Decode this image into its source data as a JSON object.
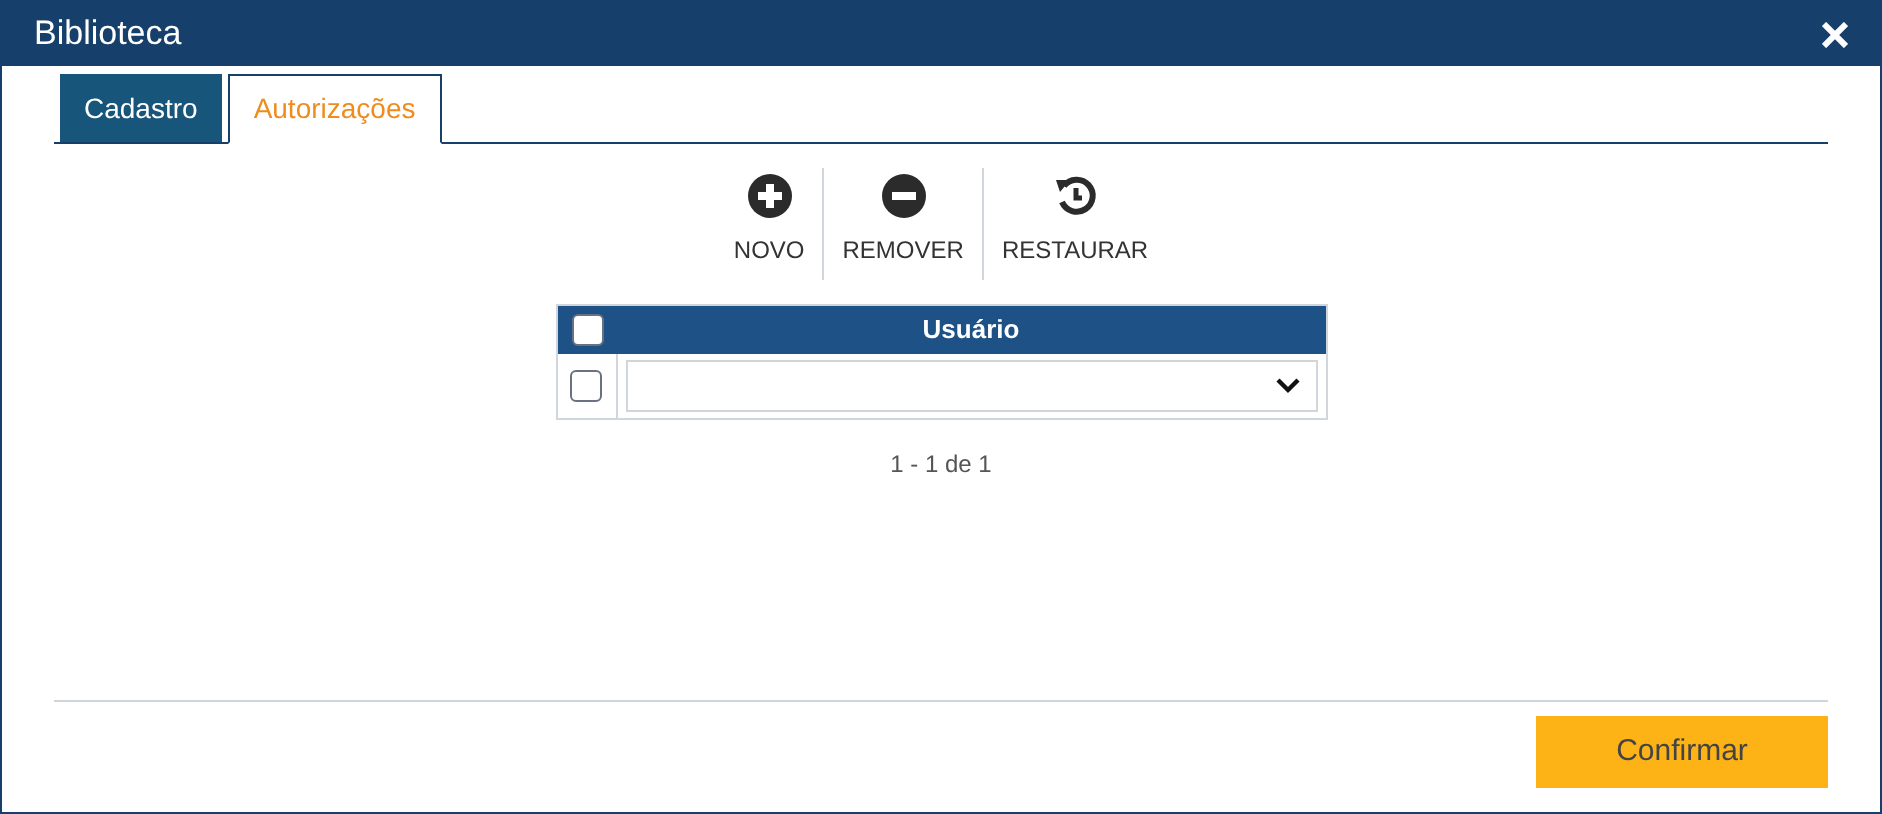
{
  "window": {
    "title": "Biblioteca"
  },
  "tabs": [
    {
      "label": "Cadastro",
      "selected": false
    },
    {
      "label": "Autorizações",
      "selected": true
    }
  ],
  "toolbar": [
    {
      "kind": "add",
      "label": "NOVO"
    },
    {
      "kind": "remove",
      "label": "REMOVER"
    },
    {
      "kind": "restore",
      "label": "RESTAURAR"
    }
  ],
  "table": {
    "header_checked": false,
    "columns": [
      "Usuário"
    ],
    "rows": [
      {
        "checked": false
      }
    ]
  },
  "pagination": "1 - 1 de 1",
  "confirm_button": "Confirmar"
}
